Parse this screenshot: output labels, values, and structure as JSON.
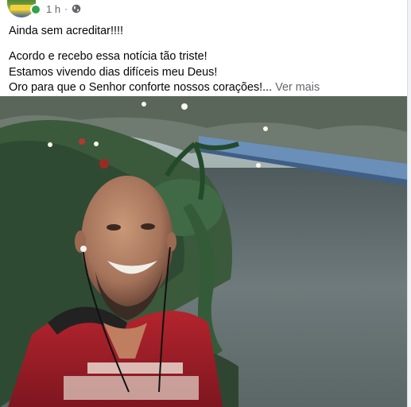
{
  "post": {
    "timestamp": "1 h",
    "separator": "·",
    "privacy_icon": "globe-icon",
    "lines": [
      "Ainda sem acreditar!!!!",
      "Acordo e recebo essa notícia tão triste!",
      "Estamos vivendo dias difíceis meu Deus!",
      "Oro para que o Senhor conforte nossos corações!..."
    ],
    "see_more": "Ver mais"
  },
  "colors": {
    "text": "#050505",
    "meta": "#65676b",
    "online": "#31a24c"
  }
}
